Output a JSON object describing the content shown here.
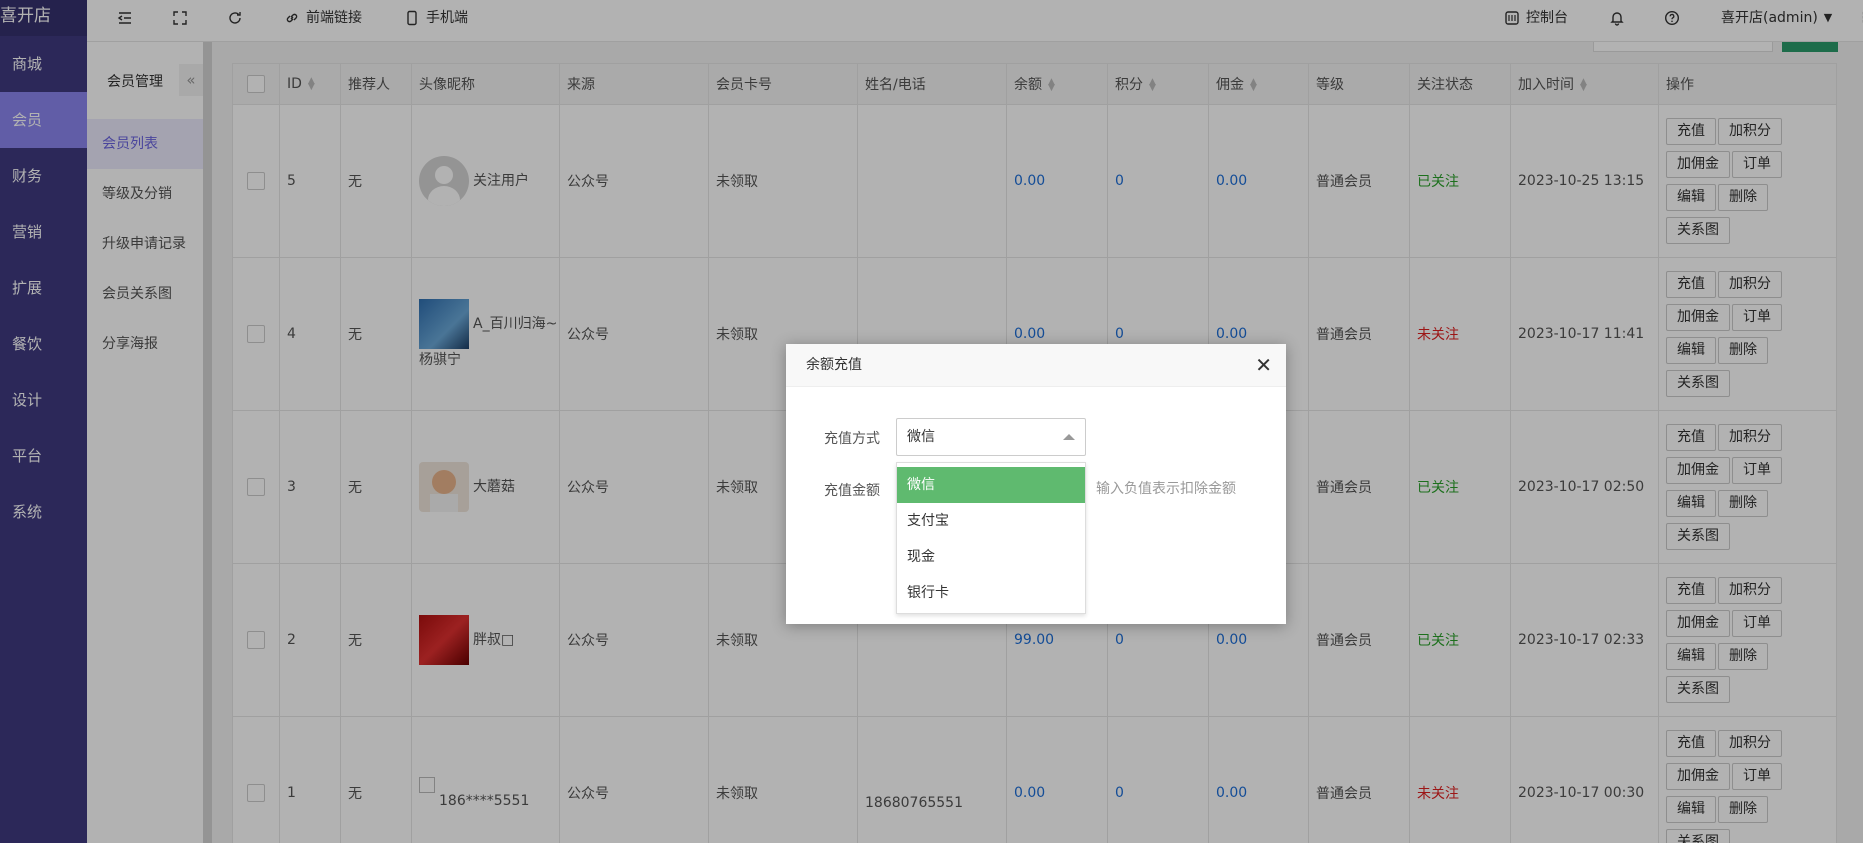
{
  "brand": "喜开店",
  "left_nav": [
    "商城",
    "会员",
    "财务",
    "营销",
    "扩展",
    "餐饮",
    "设计",
    "平台",
    "系统"
  ],
  "left_nav_active": "会员",
  "sub_nav": {
    "title": "会员管理",
    "collapse_glyph": "«",
    "items": [
      "会员列表",
      "等级及分销",
      "升级申请记录",
      "会员关系图",
      "分享海报"
    ],
    "active": "会员列表"
  },
  "topbar": {
    "frontend_link": "前端链接",
    "mobile": "手机端",
    "console": "控制台",
    "user": "喜开店(admin)"
  },
  "table": {
    "headers": [
      "",
      "ID",
      "推荐人",
      "头像昵称",
      "来源",
      "会员卡号",
      "姓名/电话",
      "余额",
      "积分",
      "佣金",
      "等级",
      "关注状态",
      "加入时间",
      "操作"
    ],
    "rows": [
      {
        "id": "5",
        "ref": "无",
        "nick": "关注用户",
        "nick2": "",
        "source": "公众号",
        "card": "未领取",
        "phone": "",
        "balance": "0.00",
        "points": "0",
        "commission": "0.00",
        "level": "普通会员",
        "follow": "已关注",
        "joined": "2023-10-25 13:15"
      },
      {
        "id": "4",
        "ref": "无",
        "nick": "A_百川归海~",
        "nick2": "杨骐宁",
        "source": "公众号",
        "card": "未领取",
        "phone": "",
        "balance": "0.00",
        "points": "0",
        "commission": "0.00",
        "level": "普通会员",
        "follow": "未关注",
        "joined": "2023-10-17 11:41"
      },
      {
        "id": "3",
        "ref": "无",
        "nick": "大蘑菇",
        "nick2": "",
        "source": "公众号",
        "card": "未领取",
        "phone": "",
        "balance": "",
        "points": "",
        "commission": "",
        "level": "普通会员",
        "follow": "已关注",
        "joined": "2023-10-17 02:50"
      },
      {
        "id": "2",
        "ref": "无",
        "nick": "胖叔□",
        "nick2": "",
        "source": "公众号",
        "card": "未领取",
        "phone": "",
        "balance": "99.00",
        "points": "0",
        "commission": "0.00",
        "level": "普通会员",
        "follow": "已关注",
        "joined": "2023-10-17 02:33"
      },
      {
        "id": "1",
        "ref": "无",
        "nick": "186****5551",
        "nick2": "",
        "source": "公众号",
        "card": "未领取",
        "phone": "18680765551",
        "balance": "0.00",
        "points": "0",
        "commission": "0.00",
        "level": "普通会员",
        "follow": "未关注",
        "joined": "2023-10-17 00:30"
      }
    ],
    "actions": [
      "充值",
      "加积分",
      "加佣金",
      "订单",
      "编辑",
      "删除",
      "关系图"
    ]
  },
  "modal": {
    "title": "余额充值",
    "close": "✕",
    "method_label": "充值方式",
    "method_value": "微信",
    "amount_label": "充值金额",
    "amount_hint": "输入负值表示扣除金额",
    "options": [
      "微信",
      "支付宝",
      "现金",
      "银行卡"
    ]
  },
  "colors": {
    "nav_bg": "#3f3a80",
    "nav_active": "#8b86f0",
    "link_blue": "#1e6fd9",
    "followed_green": "#2aa12a",
    "unfollowed_red": "#e02020",
    "option_selected": "#5fba6f"
  }
}
